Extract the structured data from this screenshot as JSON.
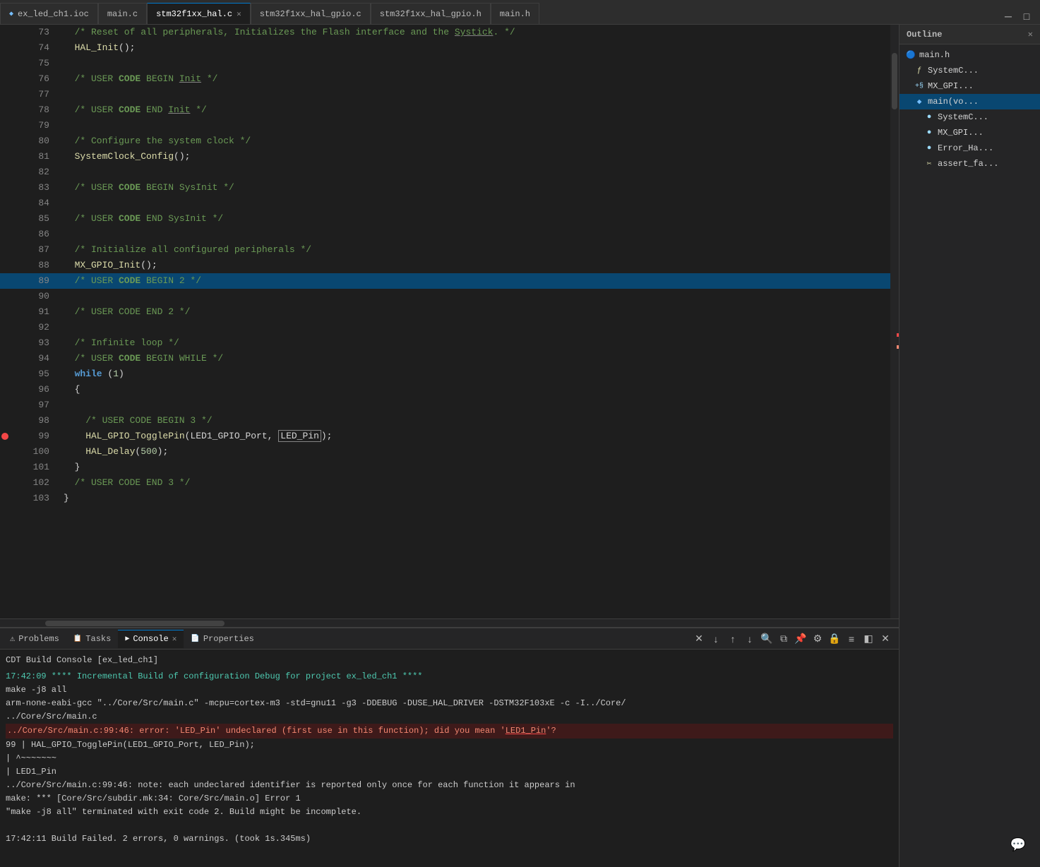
{
  "tabs": [
    {
      "id": "ex_led_ch1_ioc",
      "label": "ex_led_ch1.ioc",
      "active": false,
      "modified": false,
      "icon": "🔵"
    },
    {
      "id": "main_c",
      "label": "main.c",
      "active": false,
      "modified": false,
      "icon": ""
    },
    {
      "id": "stm32f1xx_hal_c",
      "label": "stm32f1xx_hal.c",
      "active": true,
      "modified": false,
      "icon": ""
    },
    {
      "id": "stm32f1xx_hal_gpio_c",
      "label": "stm32f1xx_hal_gpio.c",
      "active": false,
      "modified": false,
      "icon": ""
    },
    {
      "id": "stm32f1xx_hal_gpio_h",
      "label": "stm32f1xx_hal_gpio.h",
      "active": false,
      "modified": false,
      "icon": ""
    },
    {
      "id": "main_h",
      "label": "main.h",
      "active": false,
      "modified": false,
      "icon": ""
    }
  ],
  "code_lines": [
    {
      "num": 73,
      "content": "  /* Reset of all peripherals, Initializes the Flash interface and the Systick. */",
      "highlight": false,
      "error": false
    },
    {
      "num": 74,
      "content": "  HAL_Init();",
      "highlight": false,
      "error": false
    },
    {
      "num": 75,
      "content": "",
      "highlight": false,
      "error": false
    },
    {
      "num": 76,
      "content": "  /* USER CODE BEGIN Init */",
      "highlight": false,
      "error": false
    },
    {
      "num": 77,
      "content": "",
      "highlight": false,
      "error": false
    },
    {
      "num": 78,
      "content": "  /* USER CODE END Init */",
      "highlight": false,
      "error": false
    },
    {
      "num": 79,
      "content": "",
      "highlight": false,
      "error": false
    },
    {
      "num": 80,
      "content": "  /* Configure the system clock */",
      "highlight": false,
      "error": false
    },
    {
      "num": 81,
      "content": "  SystemClock_Config();",
      "highlight": false,
      "error": false
    },
    {
      "num": 82,
      "content": "",
      "highlight": false,
      "error": false
    },
    {
      "num": 83,
      "content": "  /* USER CODE BEGIN SysInit */",
      "highlight": false,
      "error": false
    },
    {
      "num": 84,
      "content": "",
      "highlight": false,
      "error": false
    },
    {
      "num": 85,
      "content": "  /* USER CODE END SysInit */",
      "highlight": false,
      "error": false
    },
    {
      "num": 86,
      "content": "",
      "highlight": false,
      "error": false
    },
    {
      "num": 87,
      "content": "  /* Initialize all configured peripherals */",
      "highlight": false,
      "error": false
    },
    {
      "num": 88,
      "content": "  MX_GPIO_Init();",
      "highlight": false,
      "error": false
    },
    {
      "num": 89,
      "content": "  /* USER CODE BEGIN 2 */",
      "highlight": true,
      "error": false
    },
    {
      "num": 90,
      "content": "",
      "highlight": false,
      "error": false
    },
    {
      "num": 91,
      "content": "  /* USER CODE END 2 */",
      "highlight": false,
      "error": false
    },
    {
      "num": 92,
      "content": "",
      "highlight": false,
      "error": false
    },
    {
      "num": 93,
      "content": "  /* Infinite loop */",
      "highlight": false,
      "error": false
    },
    {
      "num": 94,
      "content": "  /* USER CODE BEGIN WHILE */",
      "highlight": false,
      "error": false
    },
    {
      "num": 95,
      "content": "  while (1)",
      "highlight": false,
      "error": false,
      "keyword": "while"
    },
    {
      "num": 96,
      "content": "  {",
      "highlight": false,
      "error": false
    },
    {
      "num": 97,
      "content": "",
      "highlight": false,
      "error": false
    },
    {
      "num": 98,
      "content": "    /* USER CODE BEGIN 3 */",
      "highlight": false,
      "error": false
    },
    {
      "num": 99,
      "content": "    HAL_GPIO_TogglePin(LED1_GPIO_Port, LED_Pin);",
      "highlight": false,
      "error": true
    },
    {
      "num": 100,
      "content": "    HAL_Delay(500);",
      "highlight": false,
      "error": false
    },
    {
      "num": 101,
      "content": "  }",
      "highlight": false,
      "error": false
    },
    {
      "num": 102,
      "content": "  /* USER CODE END 3 */",
      "highlight": false,
      "error": false
    },
    {
      "num": 103,
      "content": "}",
      "highlight": false,
      "error": false
    }
  ],
  "bottom_tabs": [
    {
      "label": "Problems",
      "icon": "⚠",
      "active": false
    },
    {
      "label": "Tasks",
      "icon": "📋",
      "active": false
    },
    {
      "label": "Console",
      "icon": "▶",
      "active": true,
      "closeable": true
    },
    {
      "label": "Properties",
      "icon": "📄",
      "active": false
    }
  ],
  "console": {
    "title": "CDT Build Console [ex_led_ch1]",
    "lines": [
      {
        "type": "normal",
        "text": "17:42:09 **** Incremental Build of configuration Debug for project ex_led_ch1 ****"
      },
      {
        "type": "normal",
        "text": "make -j8 all"
      },
      {
        "type": "normal",
        "text": "arm-none-eabi-gcc \"../Core/Src/main.c\" -mcpu=cortex-m3 -std=gnu11 -g3 -DDEBUG -DUSE_HAL_DRIVER -DSTM32F103xE -c -I../Core/"
      },
      {
        "type": "normal",
        "text": "../Core/Src/main.c"
      },
      {
        "type": "error_line",
        "text": "../Core/Src/main.c:99:46: error: 'LED_Pin' undeclared (first use in this function); did you mean 'LED1_Pin'?"
      },
      {
        "type": "normal",
        "text": "   99 |               HAL_GPIO_TogglePin(LED1_GPIO_Port, LED_Pin);"
      },
      {
        "type": "normal",
        "text": "      |                                                  ^~~~~~~~"
      },
      {
        "type": "normal",
        "text": "      |                                                  LED1_Pin"
      },
      {
        "type": "normal",
        "text": "../Core/Src/main.c:99:46: note: each undeclared identifier is reported only once for each function it appears in"
      },
      {
        "type": "normal",
        "text": "make: *** [Core/Src/subdir.mk:34: Core/Src/main.o] Error 1"
      },
      {
        "type": "normal",
        "text": "\"make -j8 all\" terminated with exit code 2. Build might be incomplete."
      },
      {
        "type": "empty",
        "text": ""
      },
      {
        "type": "failed",
        "text": "17:42:11 Build Failed. 2 errors, 0 warnings. (took 1s.345ms)"
      }
    ]
  },
  "outline": {
    "title": "Outline",
    "items": [
      {
        "label": "main.h",
        "icon": "file",
        "indent": 0
      },
      {
        "label": "SystemC...",
        "icon": "func",
        "indent": 1
      },
      {
        "label": "MX_GPI...",
        "icon": "var",
        "indent": 1,
        "prefix": "+§"
      },
      {
        "label": "main(vo...",
        "icon": "func",
        "indent": 1,
        "active": true
      },
      {
        "label": "SystemC...",
        "icon": "dot",
        "indent": 2
      },
      {
        "label": "MX_GPI...",
        "icon": "dot",
        "indent": 2
      },
      {
        "label": "Error_Ha...",
        "icon": "dot",
        "indent": 2
      },
      {
        "label": "assert_fa...",
        "icon": "func",
        "indent": 2
      }
    ]
  },
  "colors": {
    "accent": "#007acc",
    "error": "#f44747",
    "highlight_bg": "#094771",
    "error_bg": "#3e1a1a",
    "tab_active_border": "#007acc"
  }
}
